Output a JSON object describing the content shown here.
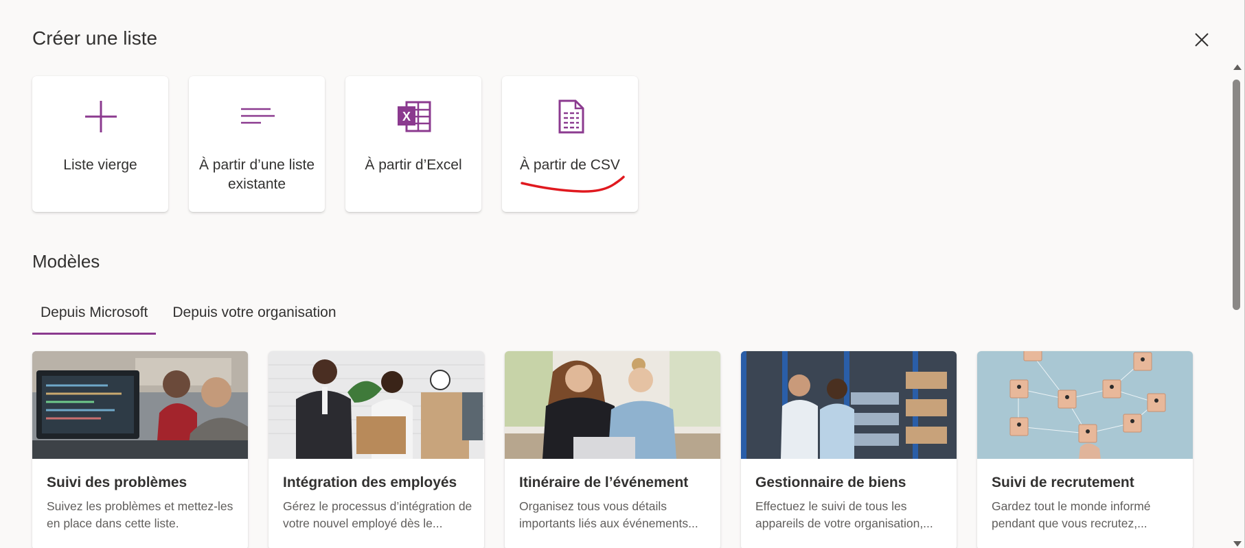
{
  "dialog": {
    "title": "Créer une liste",
    "close_icon": "close-icon"
  },
  "create_options": [
    {
      "label": "Liste vierge",
      "icon": "plus-icon"
    },
    {
      "label": "À partir d’une liste existante",
      "icon": "lines-icon"
    },
    {
      "label": "À partir d’Excel",
      "icon": "excel-icon"
    },
    {
      "label": "À partir de CSV",
      "icon": "csv-file-icon"
    }
  ],
  "templates_section": {
    "title": "Modèles",
    "tabs": [
      {
        "label": "Depuis Microsoft",
        "active": true
      },
      {
        "label": "Depuis votre organisation",
        "active": false
      }
    ]
  },
  "templates": [
    {
      "name": "Suivi des problèmes",
      "description": "Suivez les problèmes et mettez-les en place dans cette liste."
    },
    {
      "name": "Intégration des employés",
      "description": "Gérez le processus d’intégration de votre nouvel employé dès le..."
    },
    {
      "name": "Itinéraire de l’événement",
      "description": "Organisez tous vous détails importants liés aux événements..."
    },
    {
      "name": "Gestionnaire de biens",
      "description": "Effectuez le suivi de tous les appareils de votre organisation,..."
    },
    {
      "name": "Suivi de recrutement",
      "description": "Gardez tout le monde informé pendant que vous recrutez,..."
    }
  ],
  "colors": {
    "accent": "#8b3a8f",
    "annotation": "#e0191f"
  }
}
